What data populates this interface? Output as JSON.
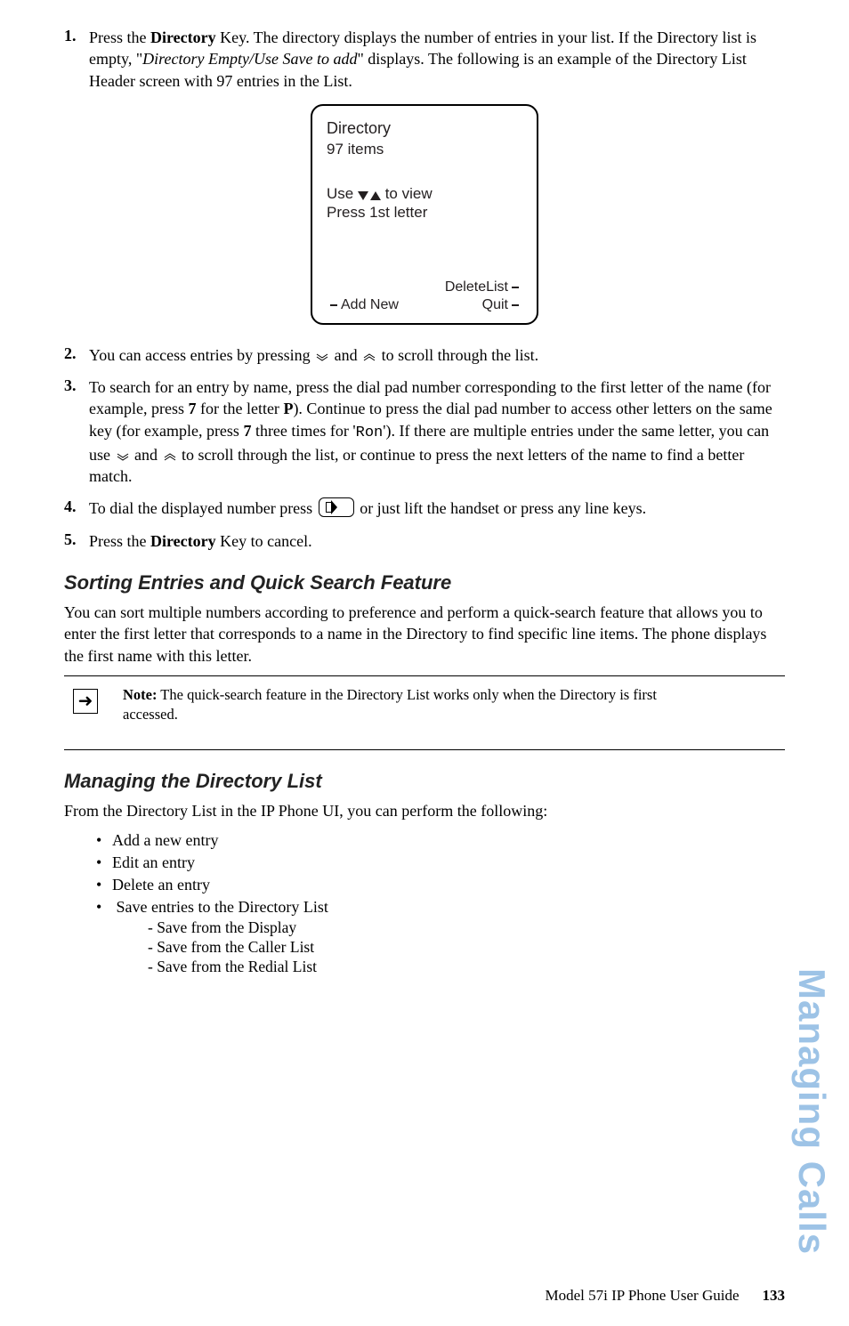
{
  "steps": {
    "s1_num": "1.",
    "s1_p1_a": "Press the ",
    "s1_p1_b": "Directory",
    "s1_p1_c": " Key. The directory displays the number of entries in your list. If the Directory list is empty, \"",
    "s1_p1_d": "Directory Empty/Use Save to add",
    "s1_p1_e": "\" displays. The following is an example of the Directory List Header screen with 97 entries in the List.",
    "s2_num": "2.",
    "s2_a": "You can access entries by pressing ",
    "s2_b": " and ",
    "s2_c": " to scroll through the list.",
    "s3_num": "3.",
    "s3_a": "To search for an entry by name, press the dial pad number corresponding to the first letter of the name (for example, press ",
    "s3_b": "7",
    "s3_c": " for the letter ",
    "s3_d": "P",
    "s3_e": "). Continue to press the dial pad number to access other letters on the same key (for example, press ",
    "s3_f": "7",
    "s3_g": " three times for '",
    "s3_h": "Ron",
    "s3_i": "'). If there are multiple entries under the same letter, you can use ",
    "s3_j": " and ",
    "s3_k": " to scroll through the list, or continue to press the next letters of the name to find a better match.",
    "s4_num": "4.",
    "s4_a": "To dial the displayed number press ",
    "s4_b": " or just lift the handset or press any line keys.",
    "s5_num": "5.",
    "s5_a": "Press the ",
    "s5_b": "Directory",
    "s5_c": " Key to cancel."
  },
  "phone": {
    "title": "Directory",
    "items": "97 items",
    "use_prefix": "Use ",
    "use_suffix": " to view",
    "press": "Press 1st letter",
    "sk_deletelist": "DeleteList",
    "sk_addnew": "Add New",
    "sk_quit": "Quit"
  },
  "sorting": {
    "heading": "Sorting Entries and Quick Search Feature",
    "body": "You can sort multiple numbers according to preference and perform a quick-search feature that allows you to enter the first letter that corresponds to a name in the Directory to find specific line items. The phone displays the first name with this letter."
  },
  "note": {
    "label": "Note:",
    "text": " The quick-search feature in the Directory List works only when the Directory is first accessed."
  },
  "managing": {
    "heading": "Managing the Directory List",
    "intro": "From the Directory List in the IP Phone UI, you can perform the following:",
    "b1": "Add a new entry",
    "b2": "Edit an entry",
    "b3": "Delete an entry",
    "b4": "Save entries to the Directory List",
    "s1": "- Save from the Display",
    "s2": "- Save from the Caller List",
    "s3": "- Save from the Redial List"
  },
  "side": "Managing Calls",
  "footer": {
    "title": "Model 57i IP Phone User Guide",
    "page": "133"
  }
}
